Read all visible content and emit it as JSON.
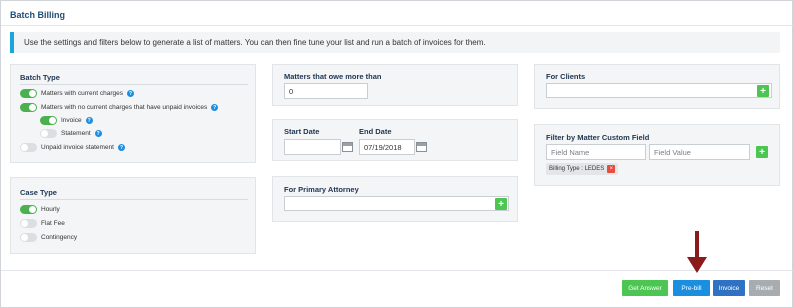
{
  "page": {
    "title": "Batch Billing"
  },
  "info": {
    "text": "Use the settings and filters below to generate a list of matters. You can then fine tune your list and run a batch of invoices for them."
  },
  "batch_type": {
    "heading": "Batch Type",
    "options": [
      {
        "label": "Matters with current charges",
        "on": true
      },
      {
        "label": "Matters with no current charges that have unpaid invoices",
        "on": true
      },
      {
        "label": "Invoice",
        "on": true
      },
      {
        "label": "Statement",
        "on": false
      },
      {
        "label": "Unpaid invoice statement",
        "on": false
      }
    ]
  },
  "case_type": {
    "heading": "Case Type",
    "options": [
      {
        "label": "Hourly",
        "on": true
      },
      {
        "label": "Flat Fee",
        "on": false
      },
      {
        "label": "Contingency",
        "on": false
      }
    ]
  },
  "owe": {
    "heading": "Matters that owe more than",
    "value": "0"
  },
  "dates": {
    "start_label": "Start Date",
    "start_value": "",
    "end_label": "End Date",
    "end_value": "07/19/2018"
  },
  "attorney": {
    "heading": "For Primary Attorney",
    "value": ""
  },
  "clients": {
    "heading": "For Clients",
    "value": ""
  },
  "custom_field": {
    "heading": "Filter by Matter Custom Field",
    "name_placeholder": "Field Name",
    "value_placeholder": "Field Value",
    "tag": "Billing Type : LEDES"
  },
  "buttons": {
    "get_answer": "Get Answer",
    "pre_bill": "Pre-bill",
    "invoice": "Invoice",
    "reset": "Reset"
  },
  "colors": {
    "accent": "#1aa6d8",
    "toggle_on": "#4caf50",
    "add": "#4cc552",
    "pre_bill": "#1b8ee0",
    "invoice": "#2f72c4",
    "reset": "#a7acb1",
    "arrow": "#8b1a1a"
  }
}
